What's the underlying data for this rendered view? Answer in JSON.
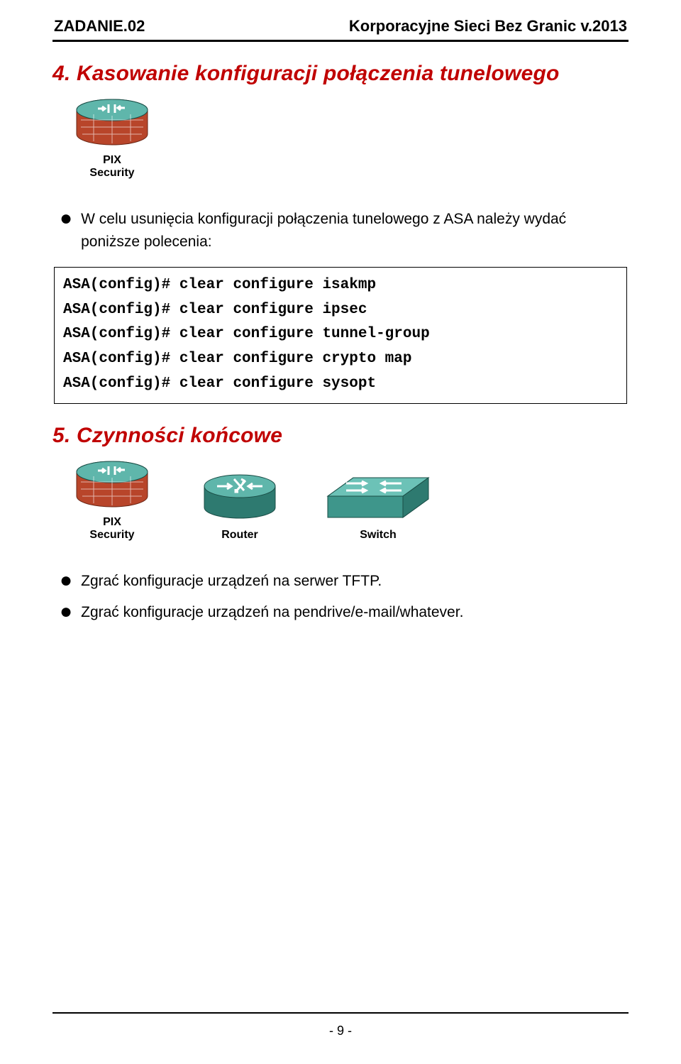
{
  "header": {
    "left": "ZADANIE.02",
    "right": "Korporacyjne Sieci Bez Granic v.2013"
  },
  "section4": {
    "title": "4. Kasowanie konfiguracji połączenia tunelowego",
    "device_label": "PIX\nSecurity",
    "intro_text": "W celu usunięcia konfiguracji połączenia tunelowego z ASA należy wydać poniższe polecenia:",
    "code": "ASA(config)# clear configure isakmp\nASA(config)# clear configure ipsec\nASA(config)# clear configure tunnel-group\nASA(config)# clear configure crypto map\nASA(config)# clear configure sysopt"
  },
  "section5": {
    "title": "5. Czynności końcowe",
    "devices": {
      "pix": "PIX\nSecurity",
      "router": "Router",
      "switch": "Switch"
    },
    "bullets": [
      "Zgrać konfiguracje urządzeń na serwer TFTP.",
      "Zgrać konfiguracje urządzeń na pendrive/e-mail/whatever."
    ]
  },
  "footer": {
    "page": "- 9 -"
  }
}
